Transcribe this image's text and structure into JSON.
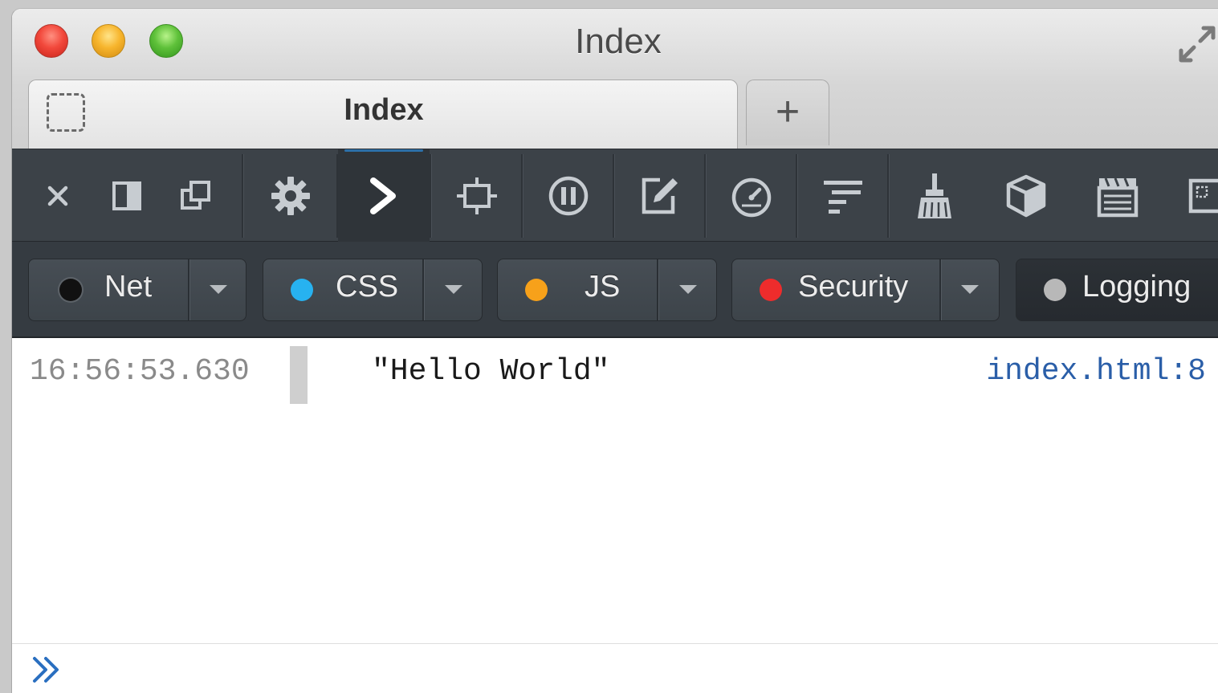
{
  "window": {
    "title": "Index",
    "controls": [
      "close",
      "minimize",
      "zoom",
      "fullscreen"
    ]
  },
  "tabs": {
    "active_label": "Index",
    "new_tab_label": "+"
  },
  "toolbar": {
    "buttons": [
      {
        "name": "close-devtools",
        "icon": "close-icon"
      },
      {
        "name": "dock-side",
        "icon": "dock-side-icon"
      },
      {
        "name": "undock",
        "icon": "undock-icon"
      },
      {
        "name": "settings",
        "icon": "gear-icon"
      },
      {
        "name": "console",
        "icon": "console-chevron-icon",
        "active": true
      },
      {
        "name": "inspect",
        "icon": "inspect-element-icon"
      },
      {
        "name": "debugger",
        "icon": "pause-icon"
      },
      {
        "name": "style-editor",
        "icon": "style-editor-icon"
      },
      {
        "name": "performance",
        "icon": "stopwatch-icon"
      },
      {
        "name": "network",
        "icon": "network-waterfall-icon"
      },
      {
        "name": "storage-clear",
        "icon": "broom-icon"
      },
      {
        "name": "3d-view",
        "icon": "cube-icon"
      },
      {
        "name": "recording",
        "icon": "clapperboard-icon"
      },
      {
        "name": "responsive",
        "icon": "responsive-icon"
      }
    ]
  },
  "filters": [
    {
      "label": "Net",
      "color": "#1a1a1a"
    },
    {
      "label": "CSS",
      "color": "#27b2f0"
    },
    {
      "label": "JS",
      "color": "#f7a11a"
    },
    {
      "label": "Security",
      "color": "#ee2c2c"
    },
    {
      "label": "Logging",
      "color": "#b8b8b8"
    }
  ],
  "console": {
    "entries": [
      {
        "time": "16:56:53.630",
        "message": "\"Hello World\"",
        "source": "index.html:8"
      }
    ],
    "prompt_icon": "double-chevron-icon"
  },
  "colors": {
    "toolbar_bg": "#3c4248",
    "filterbar_bg": "#353b41",
    "link": "#2a5ea8",
    "accent": "#2c6fa8"
  }
}
